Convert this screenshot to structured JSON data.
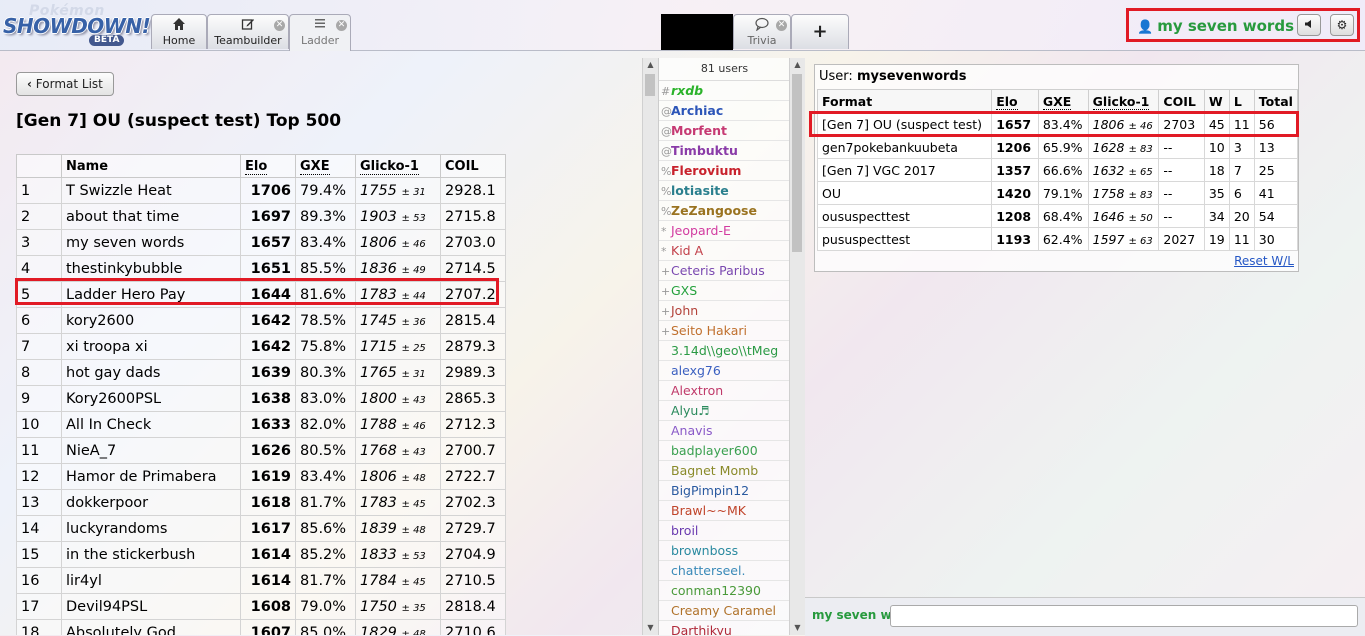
{
  "header": {
    "logo": {
      "top": "Pokémon",
      "main": "SHOWDOWN!",
      "badge": "BETA"
    },
    "tabs": [
      {
        "label": "Home",
        "icon": "home-icon",
        "closable": false
      },
      {
        "label": "Teambuilder",
        "icon": "edit-icon",
        "closable": true
      },
      {
        "label": "Ladder",
        "icon": "list-icon",
        "closable": true,
        "active": true
      }
    ],
    "room_tabs": [
      {
        "label": "Trivia",
        "icon": "chat-bubble-icon",
        "closable": true
      },
      {
        "label": "+",
        "icon": "plus-icon"
      }
    ],
    "user": {
      "name": "my seven words",
      "icon": "user-icon"
    },
    "buttons": {
      "sound": "sound-icon",
      "options": "gear-icon"
    }
  },
  "ladder": {
    "back_button": "Format List",
    "title": "[Gen 7] OU (suspect test) Top 500",
    "columns": [
      "",
      "Name",
      "Elo",
      "GXE",
      "Glicko-1",
      "COIL"
    ],
    "rows": [
      {
        "rank": "1",
        "name": "T Swizzle Heat",
        "elo": "1706",
        "gxe": "79.4%",
        "glicko": "1755",
        "dev": "± 31",
        "coil": "2928.1"
      },
      {
        "rank": "2",
        "name": "about that time",
        "elo": "1697",
        "gxe": "89.3%",
        "glicko": "1903",
        "dev": "± 53",
        "coil": "2715.8"
      },
      {
        "rank": "3",
        "name": "my seven words",
        "elo": "1657",
        "gxe": "83.4%",
        "glicko": "1806",
        "dev": "± 46",
        "coil": "2703.0"
      },
      {
        "rank": "4",
        "name": "thestinkybubble",
        "elo": "1651",
        "gxe": "85.5%",
        "glicko": "1836",
        "dev": "± 49",
        "coil": "2714.5"
      },
      {
        "rank": "5",
        "name": "Ladder Hero Pay",
        "elo": "1644",
        "gxe": "81.6%",
        "glicko": "1783",
        "dev": "± 44",
        "coil": "2707.2"
      },
      {
        "rank": "6",
        "name": "kory2600",
        "elo": "1642",
        "gxe": "78.5%",
        "glicko": "1745",
        "dev": "± 36",
        "coil": "2815.4"
      },
      {
        "rank": "7",
        "name": "xi troopa xi",
        "elo": "1642",
        "gxe": "75.8%",
        "glicko": "1715",
        "dev": "± 25",
        "coil": "2879.3"
      },
      {
        "rank": "8",
        "name": "hot gay dads",
        "elo": "1639",
        "gxe": "80.3%",
        "glicko": "1765",
        "dev": "± 31",
        "coil": "2989.3"
      },
      {
        "rank": "9",
        "name": "Kory2600PSL",
        "elo": "1638",
        "gxe": "83.0%",
        "glicko": "1800",
        "dev": "± 43",
        "coil": "2865.3"
      },
      {
        "rank": "10",
        "name": "All In Check",
        "elo": "1633",
        "gxe": "82.0%",
        "glicko": "1788",
        "dev": "± 46",
        "coil": "2712.3"
      },
      {
        "rank": "11",
        "name": "NieA_7",
        "elo": "1626",
        "gxe": "80.5%",
        "glicko": "1768",
        "dev": "± 43",
        "coil": "2700.7"
      },
      {
        "rank": "12",
        "name": "Hamor de Primabera",
        "elo": "1619",
        "gxe": "83.4%",
        "glicko": "1806",
        "dev": "± 48",
        "coil": "2722.7"
      },
      {
        "rank": "13",
        "name": "dokkerpoor",
        "elo": "1618",
        "gxe": "81.7%",
        "glicko": "1783",
        "dev": "± 45",
        "coil": "2702.3"
      },
      {
        "rank": "14",
        "name": "luckyrandoms",
        "elo": "1617",
        "gxe": "85.6%",
        "glicko": "1839",
        "dev": "± 48",
        "coil": "2729.7"
      },
      {
        "rank": "15",
        "name": "in the stickerbush",
        "elo": "1614",
        "gxe": "85.2%",
        "glicko": "1833",
        "dev": "± 53",
        "coil": "2704.9"
      },
      {
        "rank": "16",
        "name": "lir4yl",
        "elo": "1614",
        "gxe": "81.7%",
        "glicko": "1784",
        "dev": "± 45",
        "coil": "2710.5"
      },
      {
        "rank": "17",
        "name": "Devil94PSL",
        "elo": "1608",
        "gxe": "79.0%",
        "glicko": "1750",
        "dev": "± 35",
        "coil": "2818.4"
      },
      {
        "rank": "18",
        "name": "Absolutely God",
        "elo": "1607",
        "gxe": "85.0%",
        "glicko": "1829",
        "dev": "± 48",
        "coil": "2710.6"
      }
    ]
  },
  "userlist": {
    "count": "81 users",
    "users": [
      {
        "g": "#",
        "n": "rxdb",
        "c": "#2bb32b",
        "s": "bi"
      },
      {
        "g": "@",
        "n": "Archiac",
        "c": "#2c55b8",
        "s": "b"
      },
      {
        "g": "@",
        "n": "Morfent",
        "c": "#c63a73",
        "s": "b"
      },
      {
        "g": "@",
        "n": "Timbuktu",
        "c": "#8a3ba8",
        "s": "b"
      },
      {
        "g": "%",
        "n": "Flerovium",
        "c": "#c8222c",
        "s": "b"
      },
      {
        "g": "%",
        "n": "lotiasite",
        "c": "#2a7f8d",
        "s": "b"
      },
      {
        "g": "%",
        "n": "ZeZangoose",
        "c": "#9a7320",
        "s": "b"
      },
      {
        "g": "*",
        "n": "Jeopard-E",
        "c": "#d23ba0",
        "s": ""
      },
      {
        "g": "*",
        "n": "Kid A",
        "c": "#c2404a",
        "s": ""
      },
      {
        "g": "+",
        "n": "Ceteris Paribus",
        "c": "#7a48b0",
        "s": ""
      },
      {
        "g": "+",
        "n": "GXS",
        "c": "#25a13d",
        "s": ""
      },
      {
        "g": "+",
        "n": "John",
        "c": "#b3423a",
        "s": ""
      },
      {
        "g": "+",
        "n": "Seito Hakari",
        "c": "#c0702e",
        "s": ""
      },
      {
        "g": "",
        "n": "3.14d\\\\geo\\\\tMeg",
        "c": "#2b9a45",
        "s": ""
      },
      {
        "g": "",
        "n": "alexg76",
        "c": "#3a5fc0",
        "s": ""
      },
      {
        "g": "",
        "n": "Alextron",
        "c": "#c03a6a",
        "s": ""
      },
      {
        "g": "",
        "n": "Alyu♬",
        "c": "#2a8a5c",
        "s": ""
      },
      {
        "g": "",
        "n": "Anavis",
        "c": "#8a5ac8",
        "s": ""
      },
      {
        "g": "",
        "n": "badplayer600",
        "c": "#3aa050",
        "s": ""
      },
      {
        "g": "",
        "n": "Bagnet Momb",
        "c": "#8a8a2a",
        "s": ""
      },
      {
        "g": "",
        "n": "BigPimpin12",
        "c": "#2a5aa0",
        "s": ""
      },
      {
        "g": "",
        "n": "Brawl~~MK",
        "c": "#c0442a",
        "s": ""
      },
      {
        "g": "",
        "n": "broil",
        "c": "#6a3ab0",
        "s": ""
      },
      {
        "g": "",
        "n": "brownboss",
        "c": "#2a8aa0",
        "s": ""
      },
      {
        "g": "",
        "n": "chatterseel.",
        "c": "#3a8ab8",
        "s": ""
      },
      {
        "g": "",
        "n": "conman12390",
        "c": "#4a9a3a",
        "s": ""
      },
      {
        "g": "",
        "n": "Creamy Caramel",
        "c": "#b0722a",
        "s": ""
      },
      {
        "g": "",
        "n": "Darthikyu",
        "c": "#b02a3a",
        "s": ""
      }
    ]
  },
  "userpanel": {
    "user_label": "User:",
    "username": "mysevenwords",
    "columns": [
      "Format",
      "Elo",
      "GXE",
      "Glicko-1",
      "COIL",
      "W",
      "L",
      "Total"
    ],
    "rows": [
      {
        "format": "[Gen 7] OU (suspect test)",
        "elo": "1657",
        "gxe": "83.4%",
        "glicko": "1806",
        "dev": "± 46",
        "coil": "2703",
        "w": "45",
        "l": "11",
        "total": "56"
      },
      {
        "format": "gen7pokebankuubeta",
        "elo": "1206",
        "gxe": "65.9%",
        "glicko": "1628",
        "dev": "± 83",
        "coil": "--",
        "w": "10",
        "l": "3",
        "total": "13"
      },
      {
        "format": "[Gen 7] VGC 2017",
        "elo": "1357",
        "gxe": "66.6%",
        "glicko": "1632",
        "dev": "± 65",
        "coil": "--",
        "w": "18",
        "l": "7",
        "total": "25"
      },
      {
        "format": "OU",
        "elo": "1420",
        "gxe": "79.1%",
        "glicko": "1758",
        "dev": "± 83",
        "coil": "--",
        "w": "35",
        "l": "6",
        "total": "41"
      },
      {
        "format": "oususpecttest",
        "elo": "1208",
        "gxe": "68.4%",
        "glicko": "1646",
        "dev": "± 50",
        "coil": "--",
        "w": "34",
        "l": "20",
        "total": "54"
      },
      {
        "format": "pususpecttest",
        "elo": "1193",
        "gxe": "62.4%",
        "glicko": "1597",
        "dev": "± 63",
        "coil": "2027",
        "w": "19",
        "l": "11",
        "total": "30"
      }
    ],
    "reset_link": "Reset W/L"
  },
  "chat": {
    "name": "my seven w",
    "placeholder": ""
  }
}
